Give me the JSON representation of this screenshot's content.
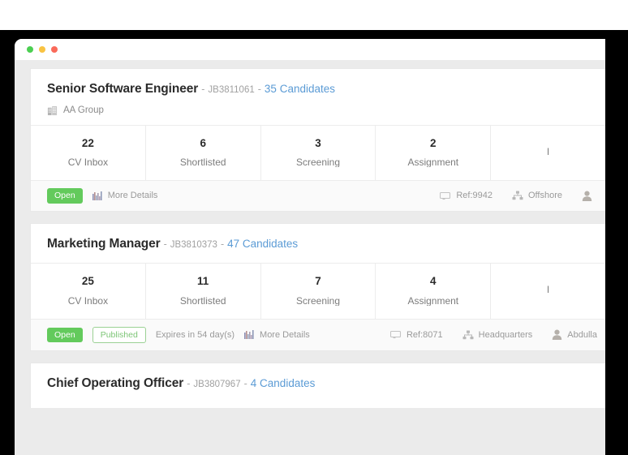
{
  "window": {
    "dots": [
      "green",
      "yellow",
      "red"
    ]
  },
  "labels": {
    "separator": "-",
    "more_details": "More Details"
  },
  "colors": {
    "link_blue": "#5b9bd5",
    "badge_open_bg": "#63ca5c",
    "badge_published_border": "#9bd194",
    "page_bg": "#ebebeb",
    "card_bg": "#ffffff",
    "footer_bg": "#fafafa"
  },
  "jobs": [
    {
      "title": "Senior Software Engineer",
      "ref_code": "JB3811061",
      "candidates": "35 Candidates",
      "company": "AA Group",
      "company_icon": "building-icon",
      "stats": [
        {
          "value": "22",
          "label": "CV Inbox"
        },
        {
          "value": "6",
          "label": "Shortlisted"
        },
        {
          "value": "3",
          "label": "Screening"
        },
        {
          "value": "2",
          "label": "Assignment"
        },
        {
          "value": "",
          "label": "I"
        }
      ],
      "status_badge": "Open",
      "published_badge": null,
      "expires": null,
      "more_details": "More Details",
      "ref_tag": "Ref:9942",
      "location": "Offshore",
      "owner": ""
    },
    {
      "title": "Marketing Manager",
      "ref_code": "JB3810373",
      "candidates": "47 Candidates",
      "company": null,
      "company_icon": null,
      "stats": [
        {
          "value": "25",
          "label": "CV Inbox"
        },
        {
          "value": "11",
          "label": "Shortlisted"
        },
        {
          "value": "7",
          "label": "Screening"
        },
        {
          "value": "4",
          "label": "Assignment"
        },
        {
          "value": "",
          "label": "I"
        }
      ],
      "status_badge": "Open",
      "published_badge": "Published",
      "expires": "Expires in 54 day(s)",
      "more_details": "More Details",
      "ref_tag": "Ref:8071",
      "location": "Headquarters",
      "owner": "Abdulla"
    },
    {
      "title": "Chief Operating Officer",
      "ref_code": "JB3807967",
      "candidates": "4 Candidates"
    }
  ]
}
